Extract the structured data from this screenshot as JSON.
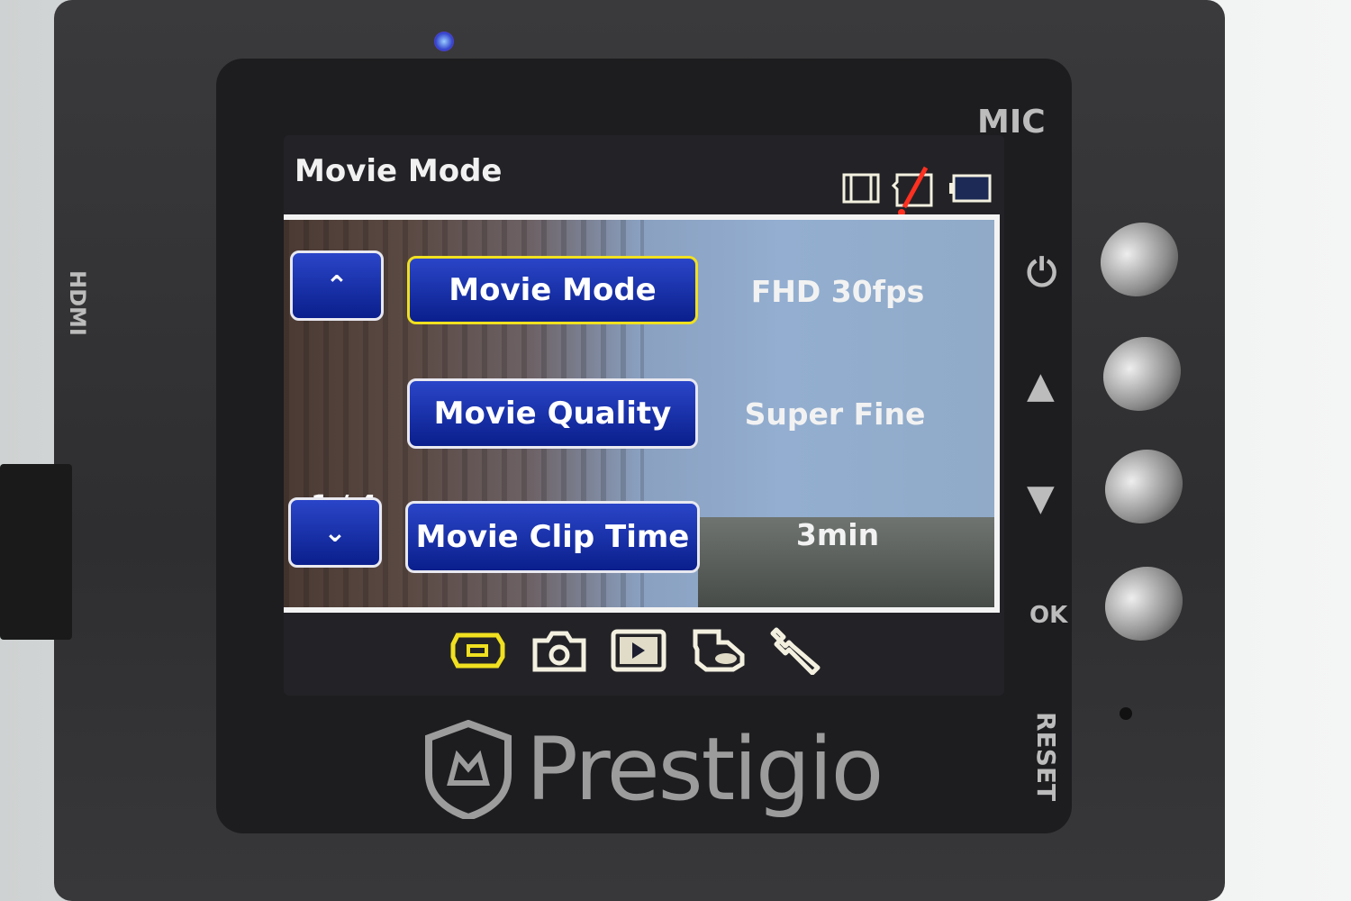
{
  "header": {
    "title": "Movie Mode",
    "status_icons": [
      "film-strip-icon",
      "no-sd-card-icon",
      "battery-icon"
    ]
  },
  "menu": {
    "page_indicator": "1 / 4",
    "rows": [
      {
        "label": "Movie Mode",
        "value": "FHD 30fps",
        "selected": true
      },
      {
        "label": "Movie Quality",
        "value": "Super Fine",
        "selected": false
      },
      {
        "label": "Movie Clip Time",
        "value": "3min",
        "selected": false
      }
    ],
    "up_glyph": "⌃",
    "down_glyph": "⌄"
  },
  "tabs": [
    {
      "icon": "video-camera-icon",
      "active": true
    },
    {
      "icon": "camera-icon",
      "active": false
    },
    {
      "icon": "playback-icon",
      "active": false
    },
    {
      "icon": "mode-icon",
      "active": false
    },
    {
      "icon": "wrench-icon",
      "active": false
    }
  ],
  "device": {
    "brand": "Prestigio",
    "mic_label": "MIC",
    "reset_label": "RESET",
    "hdmi_label": "HDMI",
    "ok_label": "OK",
    "up_label": "▲",
    "down_label": "▼",
    "power_label": "⏻"
  },
  "colors": {
    "button_blue": "#0a1f8c",
    "selected_border": "#f0e020",
    "active_tab": "#f0e020",
    "error_red": "#ff3020"
  }
}
